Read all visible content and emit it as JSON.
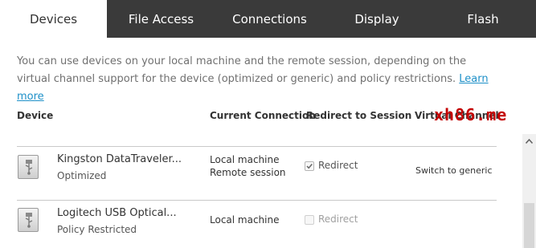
{
  "tabs": [
    {
      "label": "Devices",
      "active": true
    },
    {
      "label": "File Access",
      "active": false
    },
    {
      "label": "Connections",
      "active": false
    },
    {
      "label": "Display",
      "active": false
    },
    {
      "label": "Flash",
      "active": false
    }
  ],
  "description": {
    "text": "You can use devices on your local machine and the remote session, depending on the virtual channel support for the device (optimized or generic) and policy restrictions.",
    "link": "Learn more"
  },
  "columns": {
    "device": "Device",
    "current_connection": "Current Connection",
    "redirect": "Redirect to Session",
    "virtual": "Virtual Channel"
  },
  "devices": [
    {
      "name": "Kingston  DataTraveler...",
      "status": "Optimized",
      "connections": [
        "Local machine",
        "Remote session"
      ],
      "redirect_label": "Redirect",
      "redirect_checked": true,
      "redirect_enabled": true,
      "action": "Switch to generic",
      "icon": "usb-drive-icon"
    },
    {
      "name": "Logitech USB Optical...",
      "status": "Policy Restricted",
      "connections": [
        "Local machine"
      ],
      "redirect_label": "Redirect",
      "redirect_checked": false,
      "redirect_enabled": false,
      "action": "",
      "icon": "usb-drive-icon"
    }
  ],
  "watermark": "xh86.me",
  "colors": {
    "tabbar": "#3a3a3a",
    "link": "#1e90c8",
    "watermark": "#c40000"
  }
}
